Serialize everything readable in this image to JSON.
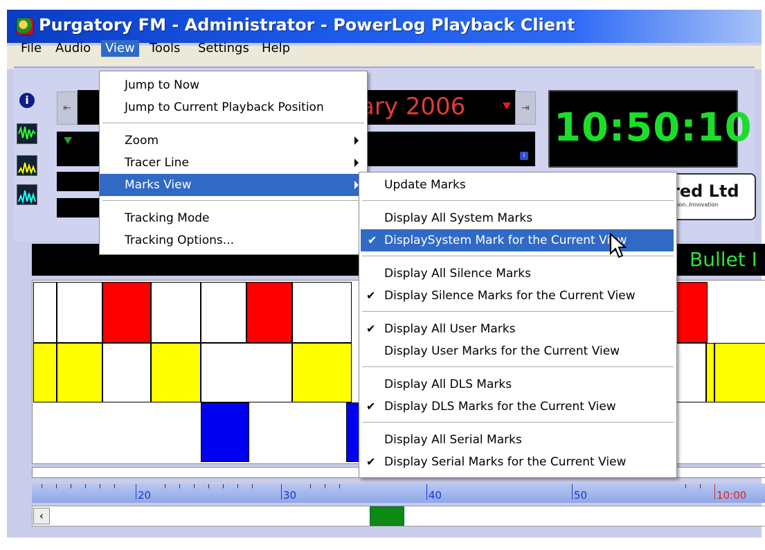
{
  "window": {
    "title": "Purgatory FM - Administrator - PowerLog Playback Client"
  },
  "menubar": {
    "items": [
      "File",
      "Audio",
      "View",
      "Tools",
      "Settings",
      "Help"
    ]
  },
  "view_menu": {
    "items": [
      {
        "label": "Jump to Now"
      },
      {
        "label": "Jump to Current Playback Position"
      },
      {
        "label": "Zoom"
      },
      {
        "label": "Tracer Line"
      },
      {
        "label": "Marks View"
      },
      {
        "label": "Tracking Mode"
      },
      {
        "label": "Tracking Options..."
      }
    ]
  },
  "marks_submenu": {
    "items": [
      {
        "label": "Update Marks",
        "checked": false
      },
      {
        "label": "Display All System Marks",
        "checked": false
      },
      {
        "label": "DisplaySystem Mark for the Current View",
        "checked": true
      },
      {
        "label": "Display All Silence Marks",
        "checked": false
      },
      {
        "label": "Display Silence Marks for the Current View",
        "checked": true
      },
      {
        "label": "Display All User Marks",
        "checked": true
      },
      {
        "label": "Display User Marks for the Current View",
        "checked": false
      },
      {
        "label": "Display All DLS Marks",
        "checked": false
      },
      {
        "label": "Display DLS Marks for the Current View",
        "checked": true
      },
      {
        "label": "Display All Serial Marks",
        "checked": false
      },
      {
        "label": "Display Serial Marks for the Current View",
        "checked": true
      }
    ]
  },
  "display": {
    "date_partial": "ary 2006",
    "clock": "10:50:10",
    "logo_text": "red Ltd",
    "logo_sub": "tion..Innovation",
    "bullet_text": "Bullet I"
  },
  "ruler": {
    "labels": [
      "20",
      "30",
      "40",
      "50",
      "10:00"
    ]
  },
  "colors": {
    "titlebar": "#0a3cc4",
    "highlight": "#316ac5",
    "clock_green": "#1bde2a",
    "date_red": "#e23b3b",
    "mark_red": "#ff0000",
    "mark_yellow": "#ffff00",
    "mark_blue": "#0000ff"
  }
}
